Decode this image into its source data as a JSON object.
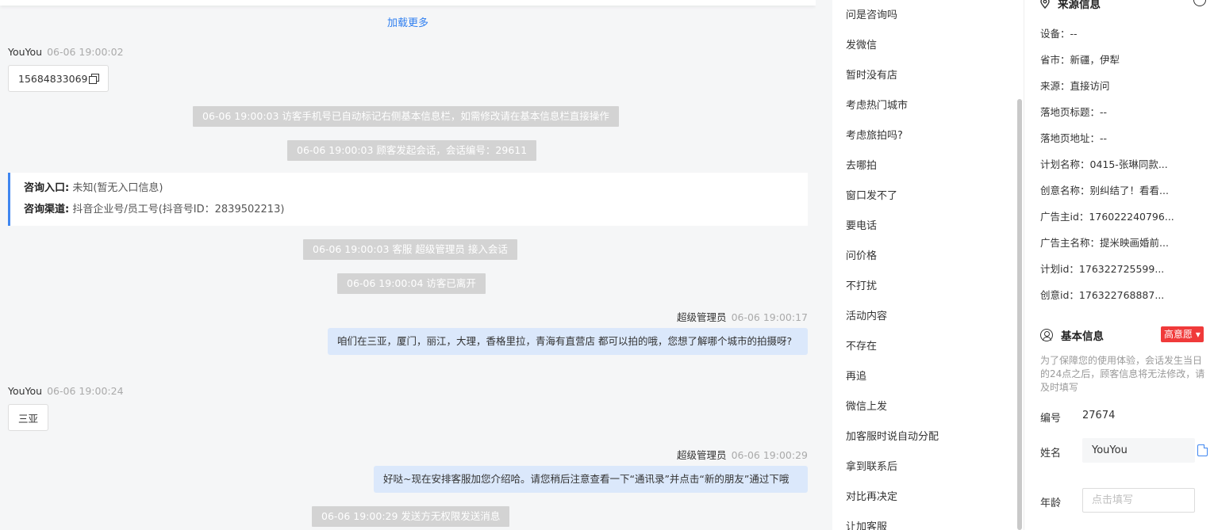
{
  "chat": {
    "load_more": "加载更多",
    "msg1": {
      "sender": "YouYou",
      "time": "06-06 19:00:02",
      "text": "15684833069"
    },
    "sys1": "06-06 19:00:03 访客手机号已自动标记右侧基本信息栏，如需修改请在基本信息栏直接操作",
    "sys2": "06-06 19:00:03 顾客发起会话，会话编号：29611",
    "entry": {
      "label1": "咨询入口:",
      "value1": " 未知(暂无入口信息)",
      "label2": "咨询渠道:",
      "value2": " 抖音企业号/员工号(抖音号ID：2839502213)"
    },
    "sys3": "06-06 19:00:03 客服 超级管理员 接入会话",
    "sys4": "06-06 19:00:04 访客已离开",
    "msg2": {
      "sender": "超级管理员",
      "time": "06-06 19:00:17",
      "text": "咱们在三亚，厦门，丽江，大理，香格里拉，青海有直营店 都可以拍的哦，您想了解哪个城市的拍摄呀?"
    },
    "msg3": {
      "sender": "YouYou",
      "time": "06-06 19:00:24",
      "text": "三亚"
    },
    "msg4": {
      "sender": "超级管理员",
      "time": "06-06 19:00:29",
      "text": "好哒~现在安排客服加您介绍哈。请您稍后注意查看一下“通讯录”并点击“新的朋友”通过下哦"
    },
    "sys5": "06-06 19:00:29 发送方无权限发送消息"
  },
  "quick_replies": [
    "问是咨询吗",
    "发微信",
    "暂时没有店",
    "考虑热门城市",
    "考虑旅拍吗?",
    "去哪拍",
    "窗口发不了",
    "要电话",
    "问价格",
    "不打扰",
    "活动内容",
    "不存在",
    "再追",
    "微信上发",
    "加客服时说自动分配",
    "拿到联系后",
    "对比再决定",
    "让加客服"
  ],
  "source_info": {
    "title": "来源信息",
    "lines": [
      "设备：--",
      "省市：新疆，伊犁",
      "来源：直接访问",
      "落地页标题：--",
      "落地页地址：--",
      "计划名称：0415-张琳同款...",
      "创意名称：别纠结了！看看...",
      "广告主id：176022240796...",
      "广告主名称：提米映画婚前...",
      "计划id：176322725599...",
      "创意id：176322768887..."
    ]
  },
  "basic_info": {
    "title": "基本信息",
    "intent": "高意愿 ▾",
    "note": "为了保障您的使用体验，会话发生当日的24点之后，顾客信息将无法修改，请及时填写",
    "id_label": "编号",
    "id_value": "27674",
    "name_label": "姓名",
    "name_value": "YouYou",
    "age_label": "年龄",
    "age_placeholder": "点击填写"
  }
}
